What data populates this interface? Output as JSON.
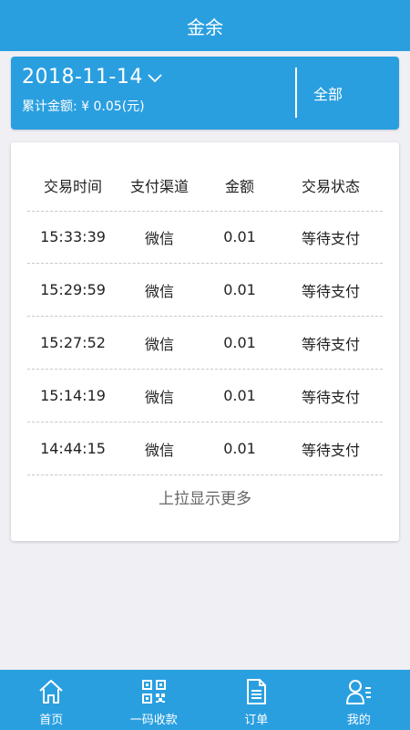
{
  "header": {
    "title": "金余"
  },
  "filter": {
    "date": "2018-11-14",
    "total_label": "累计金额: ¥ 0.05(元)",
    "channel_option": "全部"
  },
  "table": {
    "columns": [
      "交易时间",
      "支付渠道",
      "金额",
      "交易状态"
    ],
    "rows": [
      [
        "15:33:39",
        "微信",
        "0.01",
        "等待支付"
      ],
      [
        "15:29:59",
        "微信",
        "0.01",
        "等待支付"
      ],
      [
        "15:27:52",
        "微信",
        "0.01",
        "等待支付"
      ],
      [
        "15:14:19",
        "微信",
        "0.01",
        "等待支付"
      ],
      [
        "14:44:15",
        "微信",
        "0.01",
        "等待支付"
      ]
    ],
    "load_more": "上拉显示更多"
  },
  "tabbar": {
    "items": [
      {
        "label": "首页",
        "icon": "home-icon"
      },
      {
        "label": "一码收款",
        "icon": "qrcode-icon"
      },
      {
        "label": "订单",
        "icon": "document-icon"
      },
      {
        "label": "我的",
        "icon": "user-icon"
      }
    ]
  },
  "colors": {
    "brand": "#2a9fe0",
    "background": "#efeff4"
  }
}
